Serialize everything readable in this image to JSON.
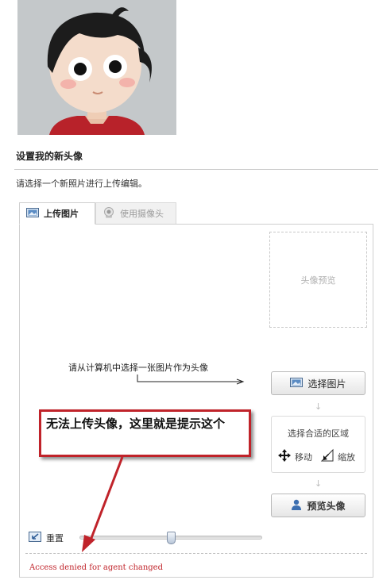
{
  "current_avatar": {
    "description_icon": "cartoon-boy-avatar"
  },
  "section": {
    "title": "设置我的新头像",
    "instruction": "请选择一个新照片进行上传编辑。"
  },
  "tabs": [
    {
      "label": "上传图片",
      "icon": "picture-icon",
      "active": true
    },
    {
      "label": "使用摄像头",
      "icon": "webcam-icon",
      "active": false
    }
  ],
  "editor": {
    "preview_label": "头像预览",
    "select_hint": "请从计算机中选择一张图片作为头像",
    "select_button": "选择图片",
    "area_label": "选择合适的区域",
    "move_label": "移动",
    "zoom_label": "缩放",
    "preview_button": "预览头像",
    "reset_label": "重置",
    "slider_value": 0.5
  },
  "annotation": {
    "text": "无法上传头像，这里就是提示这个"
  },
  "status": {
    "error": "Access denied for agent changed"
  },
  "colors": {
    "accent_red": "#c0232a",
    "panel_border": "#cfcfcf"
  }
}
